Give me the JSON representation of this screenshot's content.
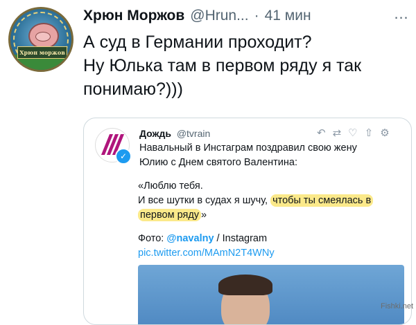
{
  "tweet": {
    "author_name": "Хрюн Моржов",
    "author_handle": "@Hrun...",
    "separator": "·",
    "time": "41 мин",
    "avatar_banner": "Хрюн моржов",
    "text_lines": [
      "А суд в Германии проходит?",
      "Ну Юлька там в первом ряду я так",
      "понимаю?)))"
    ],
    "more_label": "…"
  },
  "quote": {
    "author_name": "Дождь",
    "author_handle": "@tvrain",
    "body_line1": "Навальный в Инстаграм поздравил свою жену",
    "body_line2": "Юлию с Днем святого Валентина:",
    "quote_line1": "«Люблю тебя.",
    "quote_line2_plain": "И все шутки в судах я шучу, ",
    "quote_highlight_a": "чтобы ты смеялась в",
    "quote_highlight_b": "первом ряду",
    "quote_close": "»",
    "photo_label": "Фото: ",
    "photo_link": "@navalny",
    "photo_source": " / Instagram",
    "url": "pic.twitter.com/MAmN2T4WNy",
    "highlight_color": "#fbe98a",
    "icons": [
      "reply-icon",
      "retweet-icon",
      "like-icon",
      "share-icon",
      "settings-icon"
    ]
  },
  "watermark": "Fishki.net"
}
